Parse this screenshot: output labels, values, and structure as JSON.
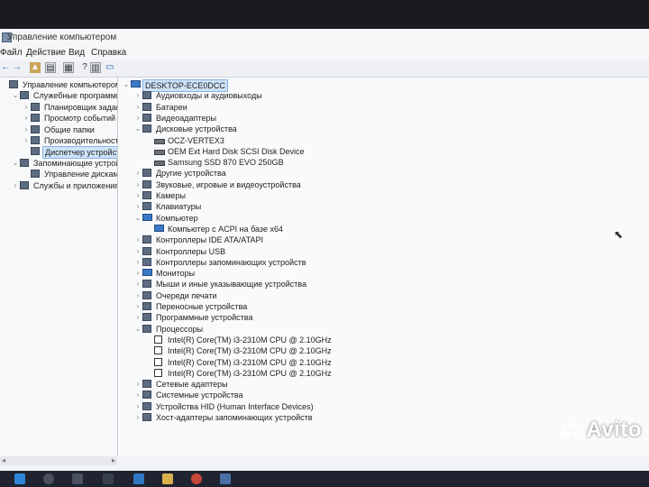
{
  "window": {
    "title": "Управление компьютером"
  },
  "menu": {
    "file": "Файл",
    "action": "Действие",
    "view": "Вид",
    "help": "Справка"
  },
  "left_tree": [
    {
      "label": "Управление компьютером (л",
      "level": 0,
      "expander": "",
      "icon": "computer-management-icon"
    },
    {
      "label": "Служебные программы",
      "level": 1,
      "expander": "v",
      "icon": "tools-icon"
    },
    {
      "label": "Планировщик заданий",
      "level": 2,
      "expander": ">",
      "icon": "clock-icon"
    },
    {
      "label": "Просмотр событий",
      "level": 2,
      "expander": ">",
      "icon": "event-viewer-icon"
    },
    {
      "label": "Общие папки",
      "level": 2,
      "expander": ">",
      "icon": "folder-icon"
    },
    {
      "label": "Производительность",
      "level": 2,
      "expander": ">",
      "icon": "performance-icon"
    },
    {
      "label": "Диспетчер устройств",
      "level": 2,
      "expander": "",
      "icon": "device-manager-icon",
      "selected": true
    },
    {
      "label": "Запоминающие устройст",
      "level": 1,
      "expander": "v",
      "icon": "storage-icon"
    },
    {
      "label": "Управление дисками",
      "level": 2,
      "expander": "",
      "icon": "disk-management-icon"
    },
    {
      "label": "Службы и приложения",
      "level": 1,
      "expander": ">",
      "icon": "services-icon"
    }
  ],
  "device_tree": [
    {
      "label": "DESKTOP-ECE0DCC",
      "level": 0,
      "expander": "v",
      "icon": "computer-icon",
      "selected": true
    },
    {
      "label": "Аудиовходы и аудиовыходы",
      "level": 1,
      "expander": ">",
      "icon": "audio-icon"
    },
    {
      "label": "Батареи",
      "level": 1,
      "expander": ">",
      "icon": "battery-icon"
    },
    {
      "label": "Видеоадаптеры",
      "level": 1,
      "expander": ">",
      "icon": "display-adapter-icon"
    },
    {
      "label": "Дисковые устройства",
      "level": 1,
      "expander": "v",
      "icon": "disk-drive-icon"
    },
    {
      "label": "OCZ-VERTEX3",
      "level": 2,
      "expander": "",
      "icon": "disk-icon"
    },
    {
      "label": "OEM  Ext Hard Disk SCSI Disk Device",
      "level": 2,
      "expander": "",
      "icon": "disk-icon"
    },
    {
      "label": "Samsung SSD 870 EVO 250GB",
      "level": 2,
      "expander": "",
      "icon": "disk-icon"
    },
    {
      "label": "Другие устройства",
      "level": 1,
      "expander": ">",
      "icon": "other-devices-icon"
    },
    {
      "label": "Звуковые, игровые и видеоустройства",
      "level": 1,
      "expander": ">",
      "icon": "sound-icon"
    },
    {
      "label": "Камеры",
      "level": 1,
      "expander": ">",
      "icon": "camera-icon"
    },
    {
      "label": "Клавиатуры",
      "level": 1,
      "expander": ">",
      "icon": "keyboard-icon"
    },
    {
      "label": "Компьютер",
      "level": 1,
      "expander": "v",
      "icon": "computer-icon"
    },
    {
      "label": "Компьютер с ACPI на базе x64",
      "level": 2,
      "expander": "",
      "icon": "monitor-icon"
    },
    {
      "label": "Контроллеры IDE ATA/ATAPI",
      "level": 1,
      "expander": ">",
      "icon": "ide-icon"
    },
    {
      "label": "Контроллеры USB",
      "level": 1,
      "expander": ">",
      "icon": "usb-icon"
    },
    {
      "label": "Контроллеры запоминающих устройств",
      "level": 1,
      "expander": ">",
      "icon": "storage-controller-icon"
    },
    {
      "label": "Мониторы",
      "level": 1,
      "expander": ">",
      "icon": "monitor-icon"
    },
    {
      "label": "Мыши и иные указывающие устройства",
      "level": 1,
      "expander": ">",
      "icon": "mouse-icon"
    },
    {
      "label": "Очереди печати",
      "level": 1,
      "expander": ">",
      "icon": "printer-icon"
    },
    {
      "label": "Переносные устройства",
      "level": 1,
      "expander": ">",
      "icon": "portable-device-icon"
    },
    {
      "label": "Программные устройства",
      "level": 1,
      "expander": ">",
      "icon": "software-device-icon"
    },
    {
      "label": "Процессоры",
      "level": 1,
      "expander": "v",
      "icon": "processor-icon"
    },
    {
      "label": "Intel(R) Core(TM) i3-2310M CPU @ 2.10GHz",
      "level": 2,
      "expander": "",
      "icon": "cpu-icon"
    },
    {
      "label": "Intel(R) Core(TM) i3-2310M CPU @ 2.10GHz",
      "level": 2,
      "expander": "",
      "icon": "cpu-icon"
    },
    {
      "label": "Intel(R) Core(TM) i3-2310M CPU @ 2.10GHz",
      "level": 2,
      "expander": "",
      "icon": "cpu-icon"
    },
    {
      "label": "Intel(R) Core(TM) i3-2310M CPU @ 2.10GHz",
      "level": 2,
      "expander": "",
      "icon": "cpu-icon"
    },
    {
      "label": "Сетевые адаптеры",
      "level": 1,
      "expander": ">",
      "icon": "network-icon"
    },
    {
      "label": "Системные устройства",
      "level": 1,
      "expander": ">",
      "icon": "system-devices-icon"
    },
    {
      "label": "Устройства HID (Human Interface Devices)",
      "level": 1,
      "expander": ">",
      "icon": "hid-icon"
    },
    {
      "label": "Хост-адаптеры запоминающих устройств",
      "level": 1,
      "expander": ">",
      "icon": "host-adapter-icon"
    }
  ],
  "watermark": "Avito",
  "colors": {
    "selection": "#cde3f7",
    "taskbar": "#1f2430",
    "accent": "#2a6db3"
  }
}
